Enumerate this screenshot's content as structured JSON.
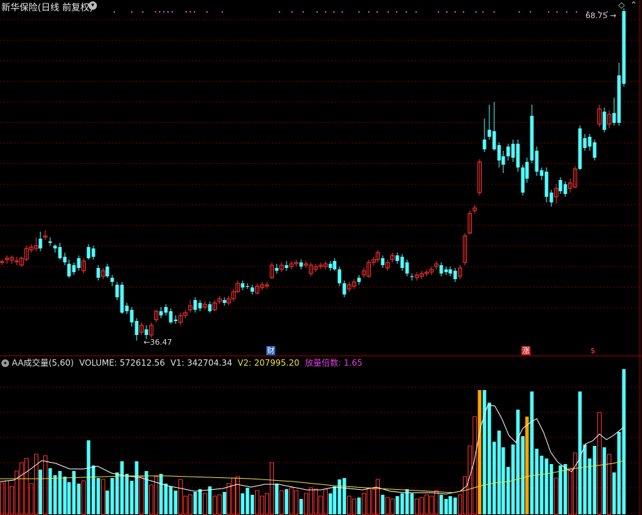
{
  "header": {
    "title": "新华保险(日线 前复权)",
    "arrow_icon": "chevron-down-icon",
    "diamond_icon": "diamond-icon",
    "collapse_icon": "collapse-icon"
  },
  "price_chart": {
    "max_label": "68.75",
    "min_label": "36.47",
    "events": [
      {
        "label": "财",
        "kind": "finance"
      },
      {
        "label": "涨",
        "kind": "limit-up"
      },
      {
        "label": "$",
        "kind": "dividend"
      }
    ]
  },
  "volume_panel": {
    "indicator": "AA成交量(5,60)",
    "volume": "VOLUME: 572612.56",
    "v1": "V1: 342704.34",
    "v2": "V2: 207995.20",
    "ratio": "放量倍数: 1.65"
  },
  "colors": {
    "up": "#ff3232",
    "down": "#54ffff",
    "grid": "#7a0000",
    "ma_fast": "#ffffff",
    "ma_slow": "#f0e040",
    "highlight": "#ffa500"
  }
}
